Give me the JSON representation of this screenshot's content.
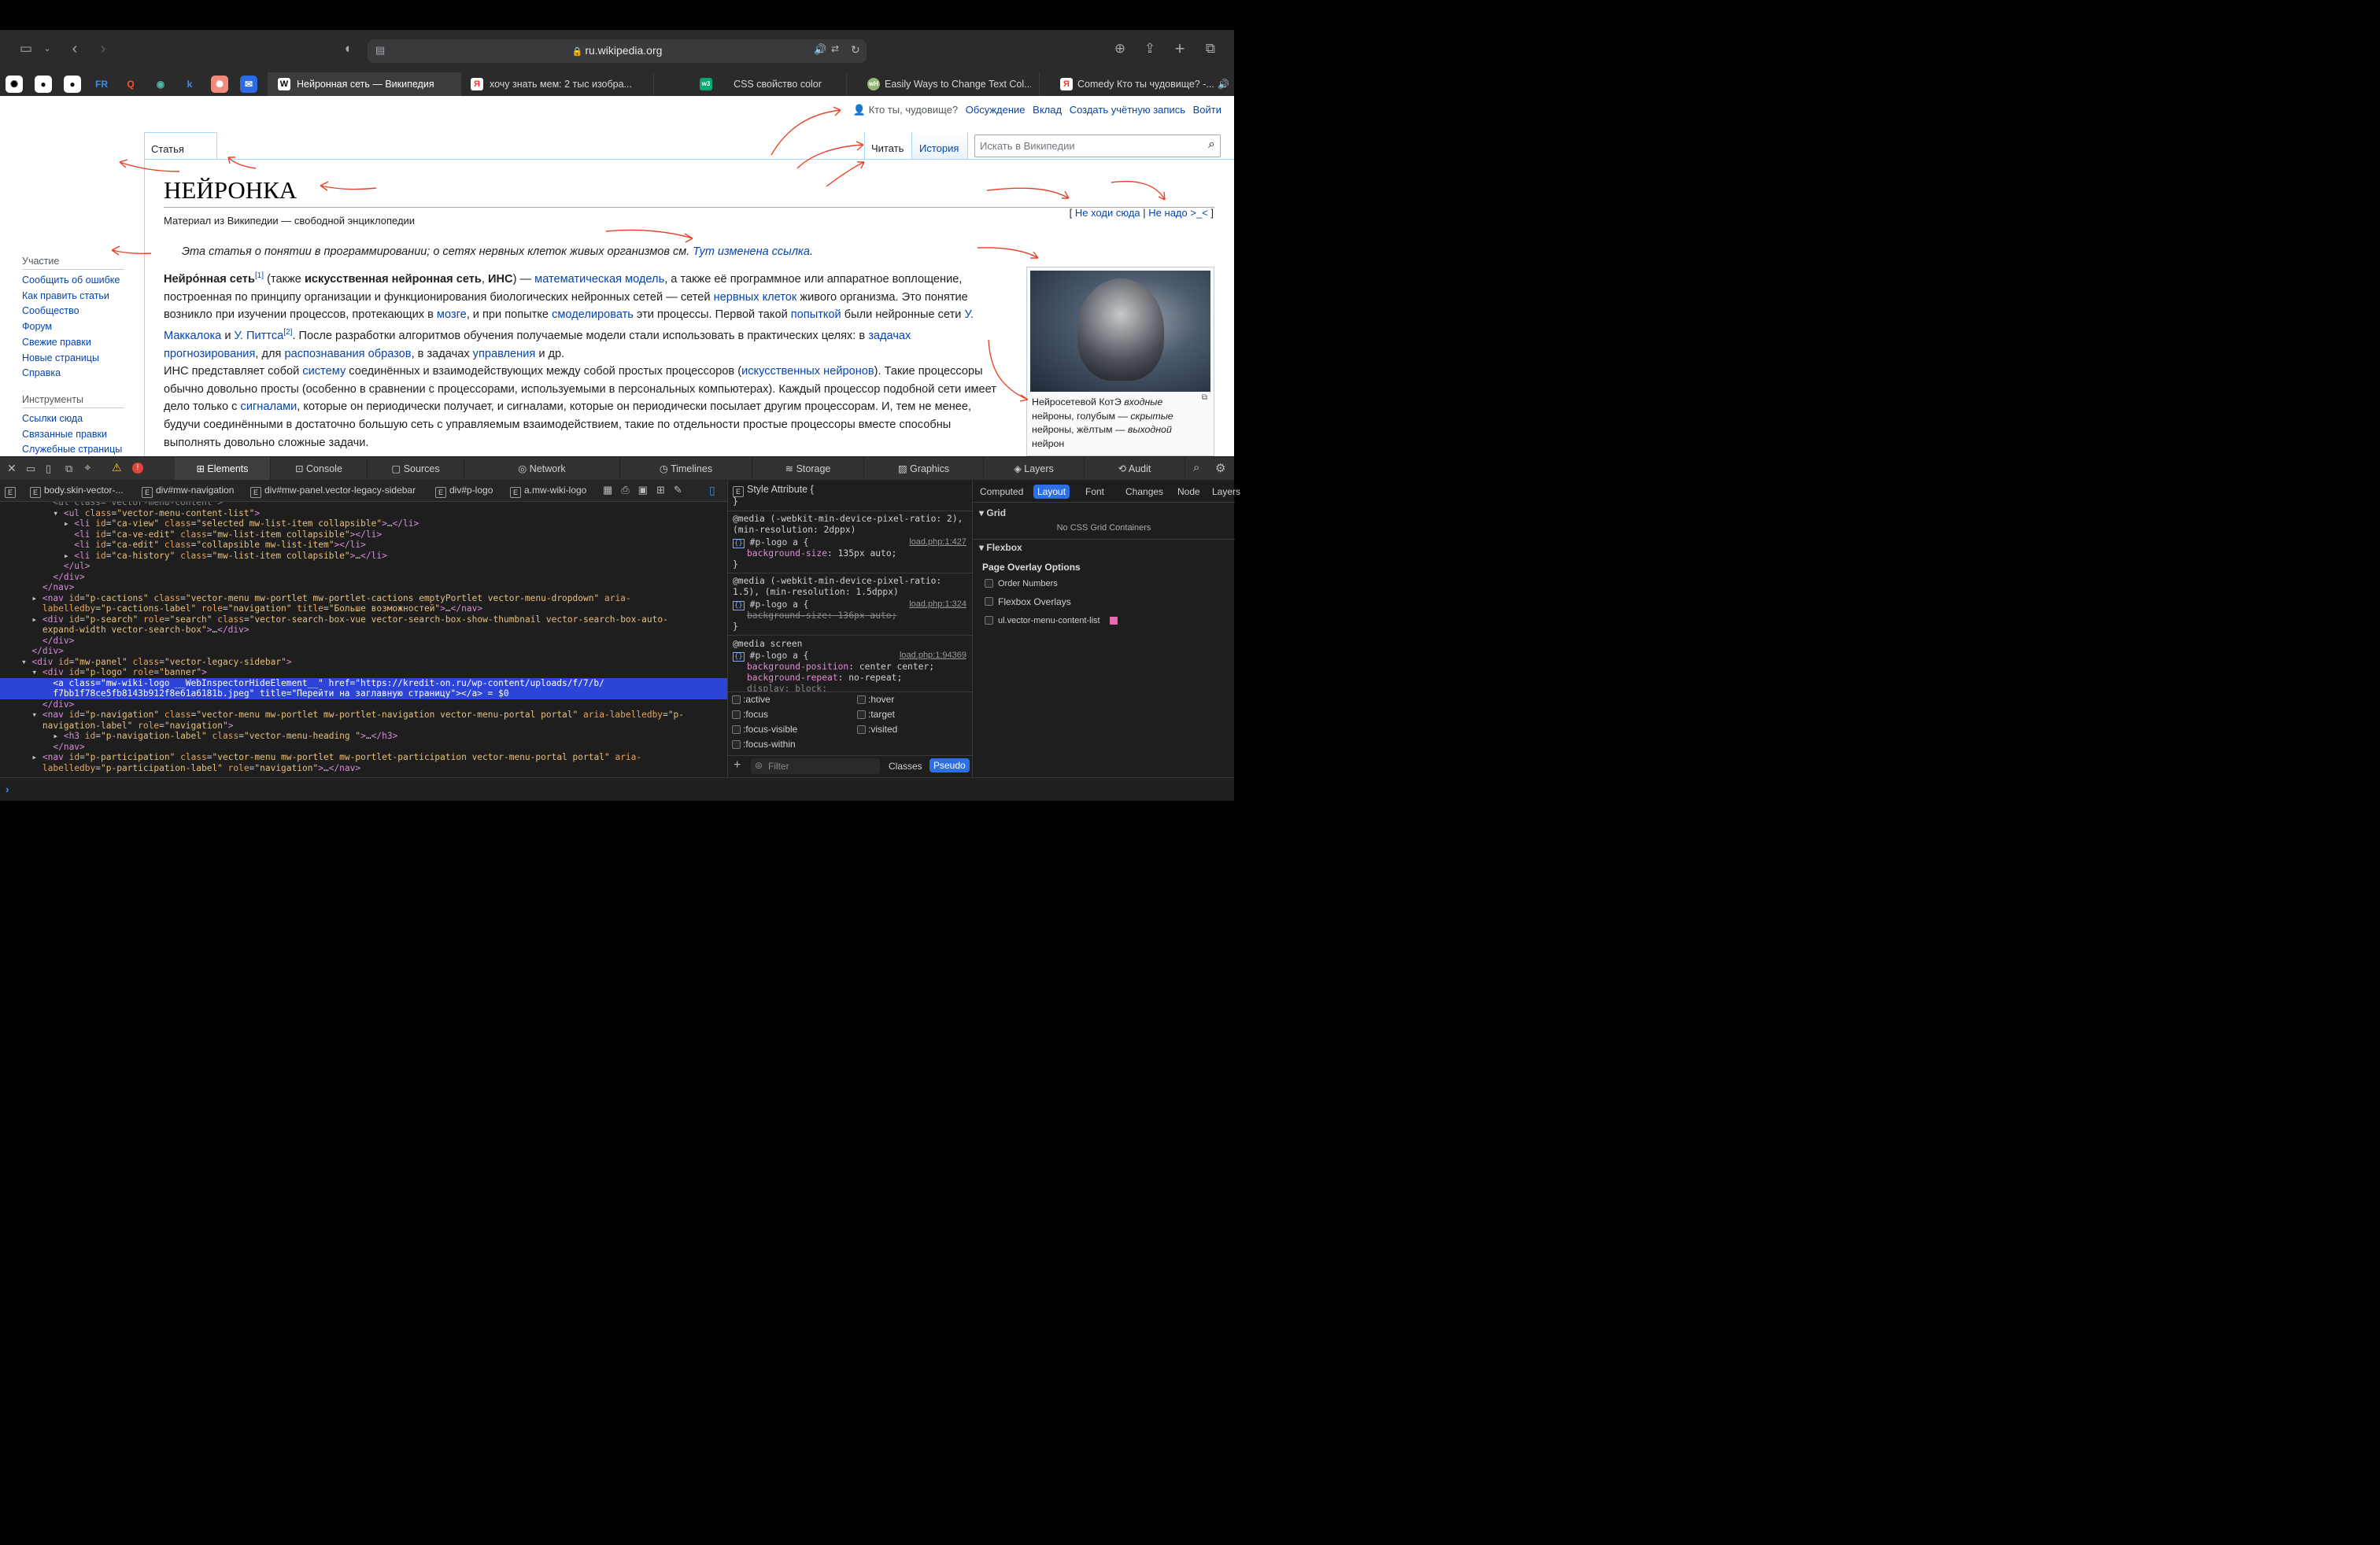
{
  "browser": {
    "url": "ru.wikipedia.org",
    "tabs": [
      {
        "label": "Нейронная сеть — Википедия",
        "icon": "W"
      },
      {
        "label": "хочу знать мем: 2 тыс изобра...",
        "icon": "Я"
      },
      {
        "label": "CSS свойство color",
        "icon": "W3"
      },
      {
        "label": "Easily Ways to Change Text Col...",
        "icon": "wh"
      },
      {
        "label": "Comedy Кто ты чудовище? -...",
        "icon": "Я"
      }
    ],
    "pinned": [
      "openai-icon",
      "github-icon",
      "github-icon",
      "fr-icon",
      "q-icon",
      "chrome-icon",
      "k-icon",
      "openai-icon",
      "mail-icon"
    ]
  },
  "wiki": {
    "personal": {
      "user": "Кто ты, чудовище?",
      "talk": "Обсуждение",
      "contrib": "Вклад",
      "create": "Создать учётную запись",
      "login": "Войти"
    },
    "tab_article": "Статья",
    "tab_read": "Читать",
    "tab_history": "История",
    "search_placeholder": "Искать в Википедии",
    "title": "НЕЙРОНКА",
    "tagline": "Материал из Википедии — свободной энциклопедии",
    "toplinks": {
      "a": "Не ходи сюда",
      "b": "Не надо >_<"
    },
    "hatnote": {
      "text": "Эта статья о понятии в программировании; о сетях нервных клеток живых организмов см. ",
      "link": "Тут изменена ссылка"
    },
    "side": {
      "participation": "Участие",
      "items": [
        "Сообщить об ошибке",
        "Как править статьи",
        "Сообщество",
        "Форум",
        "Свежие правки",
        "Новые страницы",
        "Справка"
      ],
      "tools": "Инструменты",
      "tools_items": [
        "Ссылки сюда",
        "Связанные правки",
        "Служебные страницы"
      ]
    },
    "caption": {
      "a": "Нейросетевой КотЭ ",
      "b": "входные",
      "c": " нейроны, голубым — ",
      "d": "скрытые",
      "e": " нейроны, жёлтым — ",
      "f": "выходной",
      "g": " нейрон"
    }
  },
  "devtools": {
    "tabs": [
      "Elements",
      "Console",
      "Sources",
      "Network",
      "Timelines",
      "Storage",
      "Graphics",
      "Layers",
      "Audit"
    ],
    "crumbs": [
      "body.skin-vector-...",
      "div#mw-navigation",
      "div#mw-panel.vector-legacy-sidebar",
      "div#p-logo",
      "a.mw-wiki-logo"
    ],
    "style_attr": "Style Attribute",
    "rules": [
      {
        "media": "@media (-webkit-min-device-pixel-ratio: 2), (min-resolution: 2dppx)",
        "sel": "#p-logo a",
        "src": "load.php:1:427",
        "props": [
          [
            "background-size",
            "135px auto"
          ]
        ]
      },
      {
        "media": "@media (-webkit-min-device-pixel-ratio: 1.5), (min-resolution: 1.5dppx)",
        "sel": "#p-logo a",
        "src": "load.php:1:324",
        "props": [
          [
            "background-size",
            "136px auto"
          ]
        ]
      },
      {
        "media": "@media screen",
        "sel": "#p-logo a",
        "src": "load.php:1:94369",
        "props": [
          [
            "background-position",
            "center center"
          ],
          [
            "background-repeat",
            "no-repeat"
          ]
        ]
      }
    ],
    "pseudo": [
      ":active",
      ":hover",
      ":focus",
      ":target",
      ":focus-visible",
      ":visited",
      ":focus-within"
    ],
    "filter": "Filter",
    "classes": "Classes",
    "pseudo_btn": "Pseudo",
    "rtabs": [
      "Computed",
      "Layout",
      "Font",
      "Changes",
      "Node",
      "Layers"
    ],
    "grid": "Grid",
    "no_grid": "No CSS Grid Containers",
    "flexbox": "Flexbox",
    "overlay": "Page Overlay Options",
    "opts": [
      "Order Numbers",
      "Flexbox Overlays",
      "ul.vector-menu-content-list"
    ]
  }
}
